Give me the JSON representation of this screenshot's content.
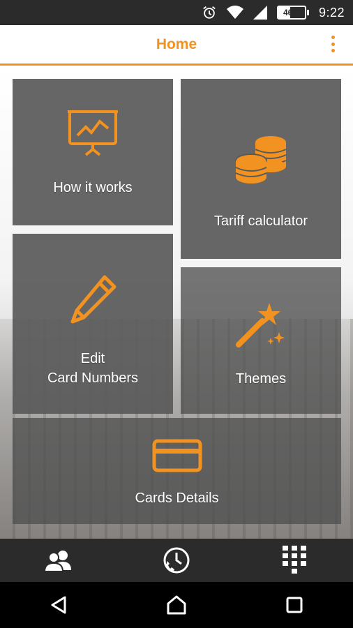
{
  "status_bar": {
    "icons": [
      "alarm-icon",
      "wifi-icon",
      "signal-icon"
    ],
    "battery_percent": "46%",
    "battery_level": 0.46,
    "time": "9:22"
  },
  "app_bar": {
    "title": "Home",
    "menu_icon": "overflow-menu-icon"
  },
  "tiles": {
    "how_it_works": {
      "label": "How it works",
      "icon": "presentation-chart-icon"
    },
    "tariff_calculator": {
      "label": "Tariff calculator",
      "icon": "coins-icon"
    },
    "edit_card_numbers": {
      "label": "Edit\nCard Numbers",
      "icon": "pencil-icon"
    },
    "themes": {
      "label": "Themes",
      "icon": "magic-wand-icon"
    },
    "cards_details": {
      "label": "Cards Details",
      "icon": "credit-card-icon"
    }
  },
  "bottom_nav": {
    "items": [
      "contacts-icon",
      "call-history-icon",
      "dialpad-icon"
    ]
  },
  "system_nav": {
    "items": [
      "back-icon",
      "home-icon",
      "recents-icon"
    ]
  },
  "colors": {
    "accent": "#f29221",
    "tile_bg": "#5a5a5a",
    "bar_dark": "#2b2b2b"
  }
}
